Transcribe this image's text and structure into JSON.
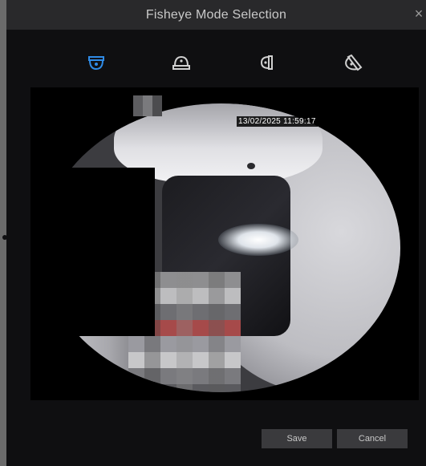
{
  "dialog": {
    "title": "Fisheye Mode Selection",
    "close_label": "×"
  },
  "modes": [
    {
      "name": "ceiling-mount",
      "icon": "ceiling-mount-icon",
      "selected": true
    },
    {
      "name": "desktop-mount",
      "icon": "desktop-mount-icon",
      "selected": false
    },
    {
      "name": "wall-mount",
      "icon": "wall-mount-icon",
      "selected": false
    },
    {
      "name": "angled-mount",
      "icon": "angled-mount-icon",
      "selected": false
    }
  ],
  "preview": {
    "timestamp": "13/02/2025 11:59:17"
  },
  "buttons": {
    "save_label": "Save",
    "cancel_label": "Cancel"
  },
  "colors": {
    "accent": "#2f8be6",
    "icon_inactive": "#d0d0d0",
    "titlebar": "#29292b",
    "dialog_bg": "#0f0f11"
  }
}
